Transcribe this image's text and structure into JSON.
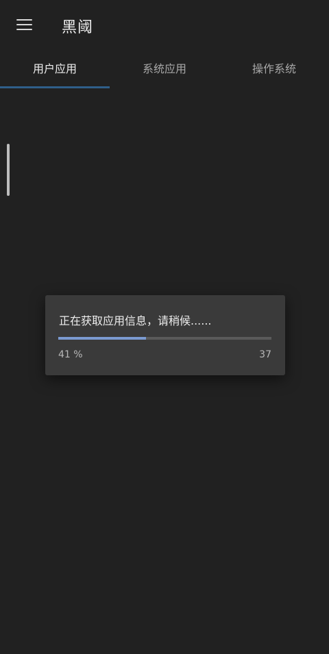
{
  "app_bar": {
    "title": "黑阈",
    "menu_icon": "menu-icon"
  },
  "tabs": [
    {
      "label": "用户应用",
      "active": true
    },
    {
      "label": "系统应用",
      "active": false
    },
    {
      "label": "操作系统",
      "active": false
    }
  ],
  "colors": {
    "background": "#212121",
    "tab_indicator": "#2f5f8a",
    "progress_fill": "#7b9bd1",
    "dialog_background": "#3a3a3a"
  },
  "dialog": {
    "message": "正在获取应用信息，请稍候......",
    "progress_percent": 41,
    "progress_percent_label": "41 %",
    "progress_count": "37"
  }
}
